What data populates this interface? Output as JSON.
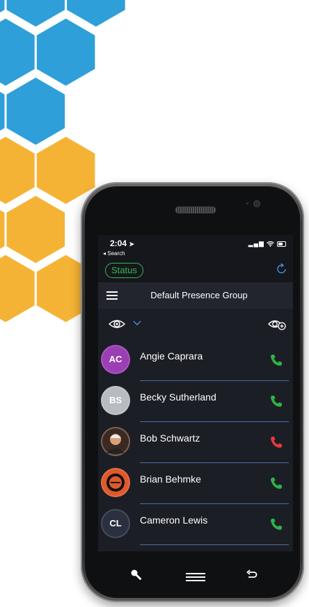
{
  "colors": {
    "blue_hex": "#2e9fd8",
    "yellow_hex": "#f5b335",
    "screen_bg": "#1c1e26",
    "status_green": "#39b54a",
    "call_green": "#2fb344",
    "call_red": "#e8393b",
    "accent_blue": "#4a90e2"
  },
  "statusbar": {
    "time": "2:04",
    "back_label": "◂ Search"
  },
  "appbar": {
    "status_label": "Status",
    "refresh_icon": "refresh-icon"
  },
  "group": {
    "menu_icon": "hamburger-icon",
    "title": "Default Presence Group"
  },
  "filter": {
    "view_icon": "eye-icon",
    "chevron_icon": "chevron-down-icon",
    "add_view_icon": "eye-add-icon"
  },
  "contacts": [
    {
      "initials": "AC",
      "name": "Angie Caprara",
      "avatar_color": "#9b3fb5",
      "call_state": "available"
    },
    {
      "initials": "BS",
      "name": "Becky Sutherland",
      "avatar_color": "#b8bcc2",
      "call_state": "available"
    },
    {
      "initials": "",
      "name": "Bob Schwartz",
      "avatar_color": "#6b4a3a",
      "call_state": "busy"
    },
    {
      "initials": "",
      "name": "Brian Behmke",
      "avatar_color": "#e0592a",
      "call_state": "available"
    },
    {
      "initials": "CL",
      "name": "Cameron Lewis",
      "avatar_color": "#2a3040",
      "call_state": "available"
    }
  ],
  "navbar": {
    "search_icon": "search-icon",
    "menu_icon": "menu-icon",
    "back_icon": "back-arrow-icon"
  }
}
